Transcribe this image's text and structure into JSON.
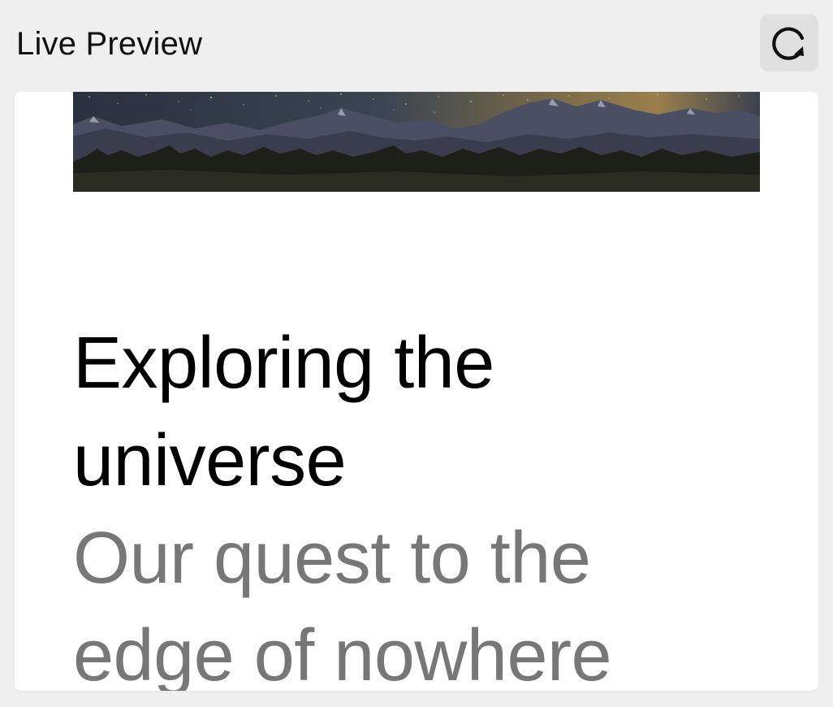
{
  "header": {
    "title": "Live Preview",
    "refresh_icon": "refresh-icon"
  },
  "preview": {
    "hero_image": "night-sky-mountains-image",
    "title": "Exploring the universe",
    "subtitle": "Our quest to the edge of nowhere"
  },
  "colors": {
    "background": "#efefef",
    "card": "#ffffff",
    "title": "#000000",
    "subtitle": "#777777",
    "button": "#e0e0e0"
  }
}
